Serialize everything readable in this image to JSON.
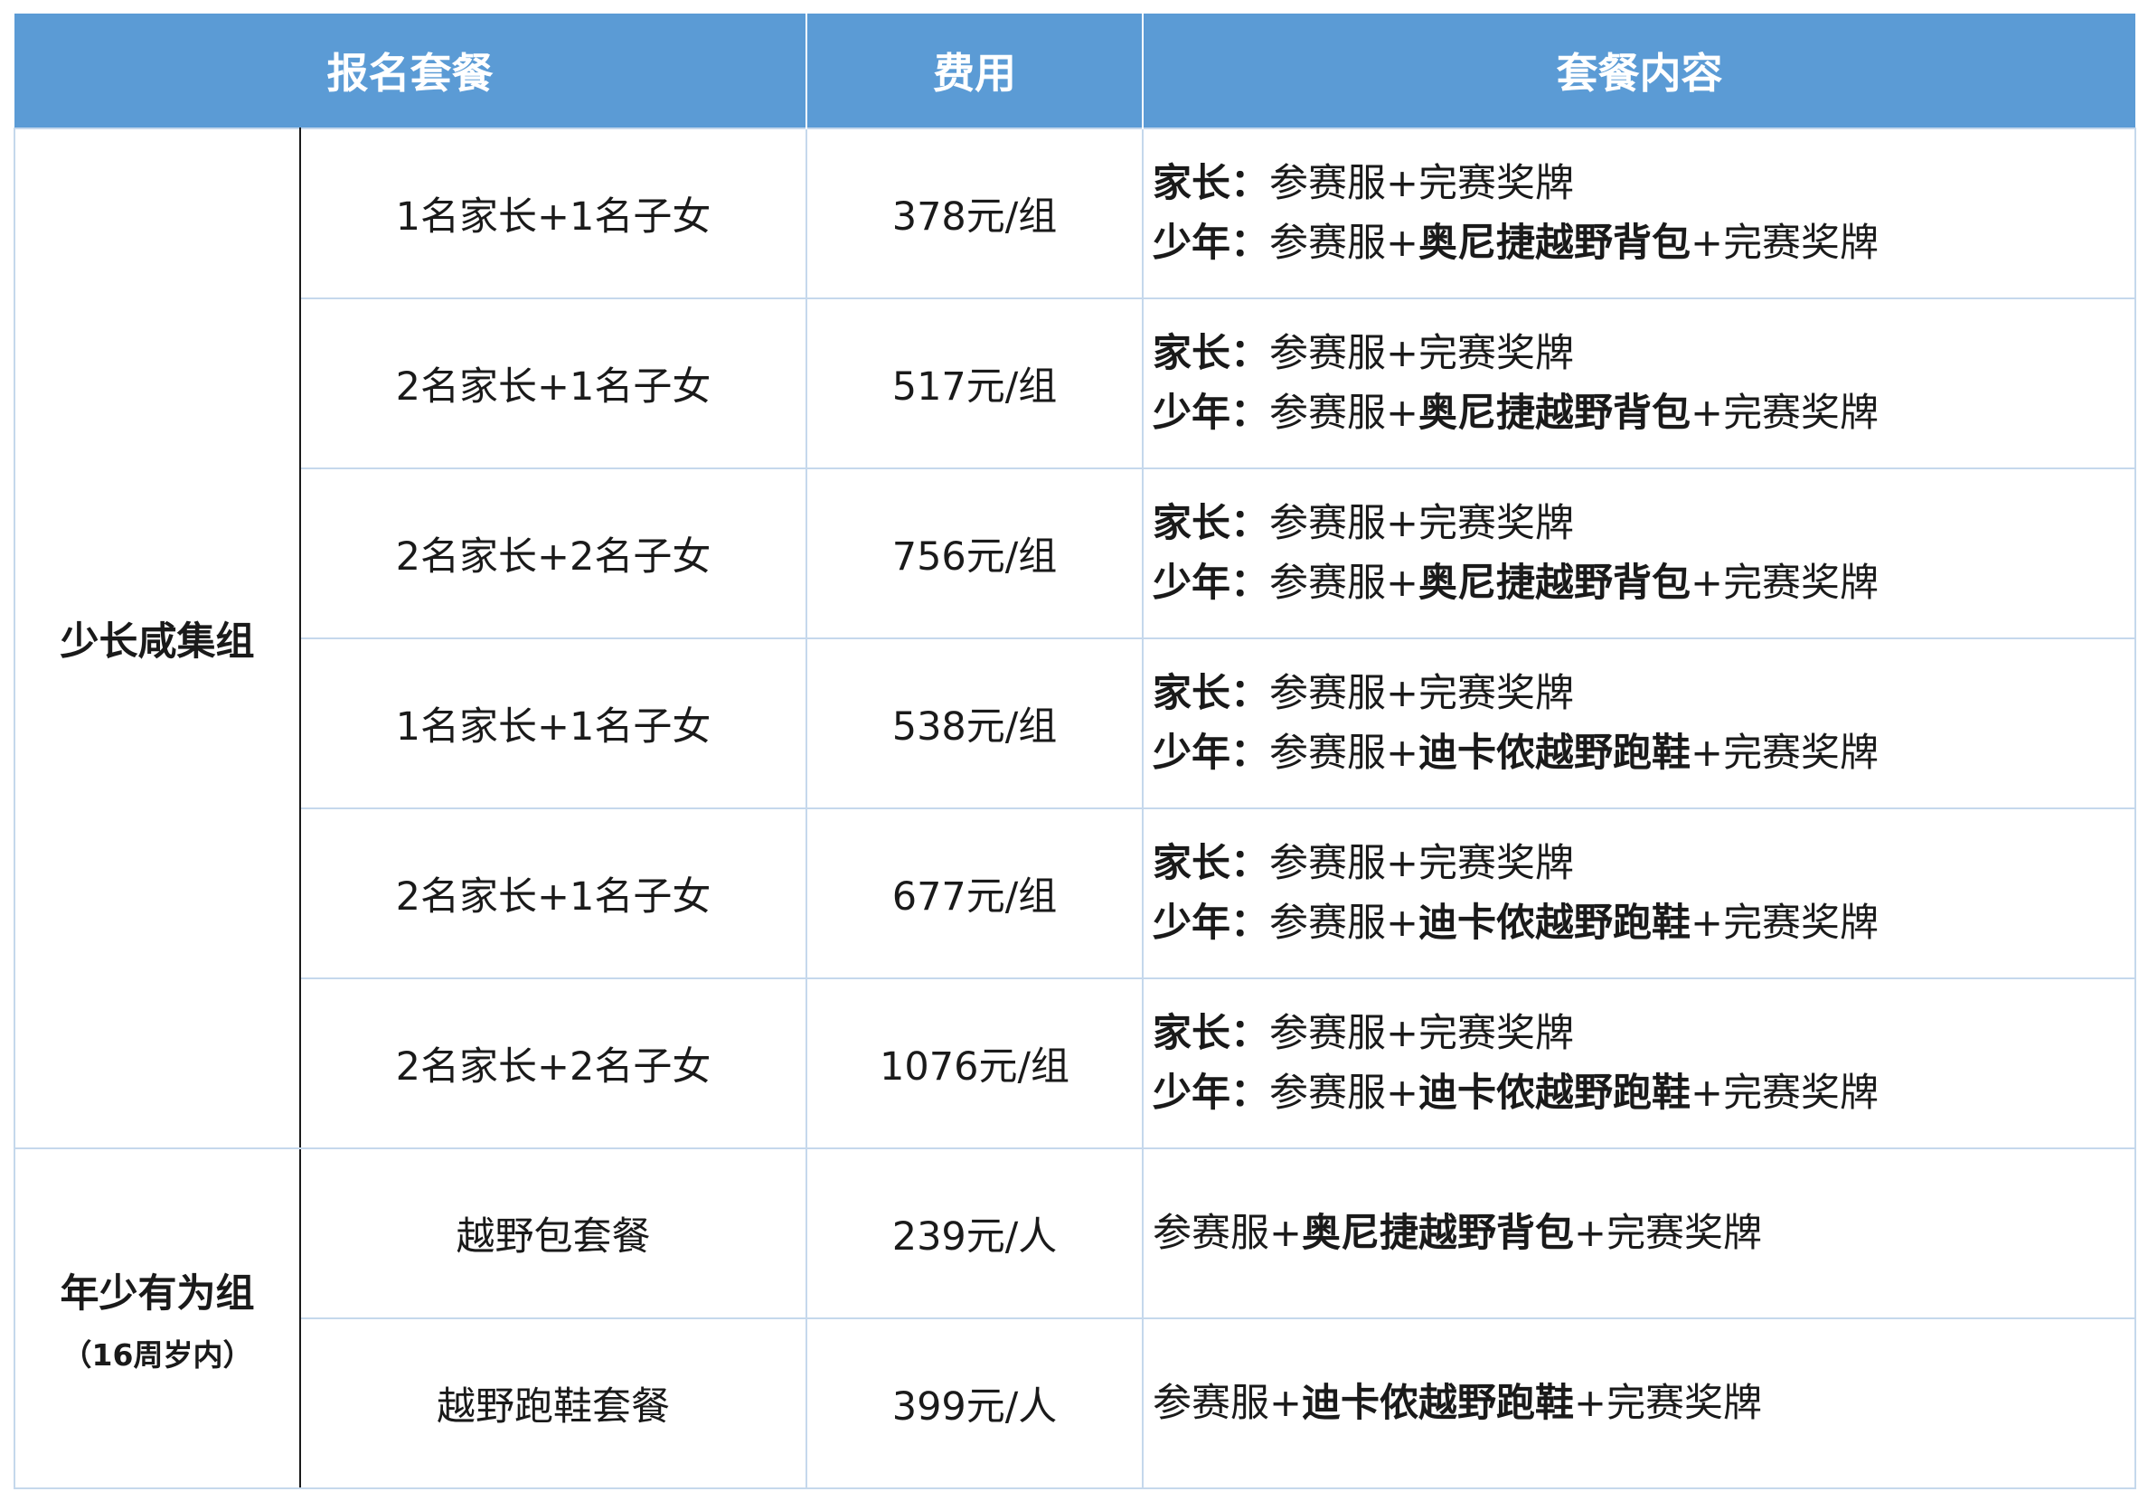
{
  "header": {
    "package": "报名套餐",
    "fee": "费用",
    "content": "套餐内容"
  },
  "groups": [
    {
      "name": "少长咸集组",
      "note": ""
    },
    {
      "name": "年少有为组",
      "note": "（16周岁内）"
    }
  ],
  "labels": {
    "parent": "家长：",
    "youth": "少年："
  },
  "parts": {
    "jersey": "参赛服",
    "plus": "+",
    "medal": "完赛奖牌",
    "backpack": "奥尼捷越野背包",
    "shoes": "迪卡侬越野跑鞋"
  },
  "rows": [
    {
      "package": "1名家长+1名子女",
      "fee": "378元/组"
    },
    {
      "package": "2名家长+1名子女",
      "fee": "517元/组"
    },
    {
      "package": "2名家长+2名子女",
      "fee": "756元/组"
    },
    {
      "package": "1名家长+1名子女",
      "fee": "538元/组"
    },
    {
      "package": "2名家长+1名子女",
      "fee": "677元/组"
    },
    {
      "package": "2名家长+2名子女",
      "fee": "1076元/组"
    },
    {
      "package": "越野包套餐",
      "fee": "239元/人"
    },
    {
      "package": "越野跑鞋套餐",
      "fee": "399元/人"
    }
  ]
}
